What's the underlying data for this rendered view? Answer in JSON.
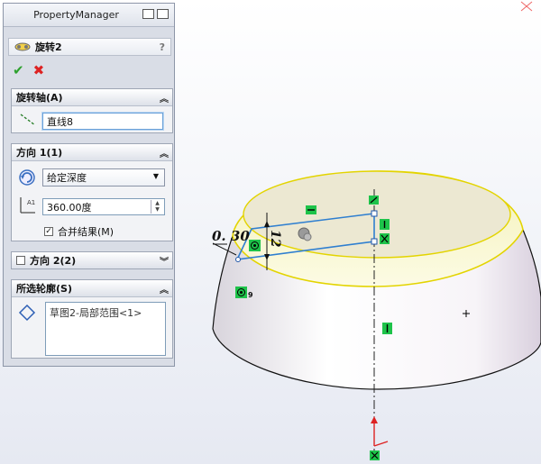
{
  "panel": {
    "title": "PropertyManager",
    "feature_name": "旋转2",
    "help": "?",
    "ok_glyph": "✔",
    "cancel_glyph": "✖"
  },
  "axis_group": {
    "title": "旋转轴(A)",
    "value": "直线8"
  },
  "direction1": {
    "title": "方向 1(1)",
    "end_condition": "给定深度",
    "angle": "360.00度",
    "merge_label": "合并结果(M)",
    "merge_checked": true
  },
  "direction2": {
    "title": "方向 2(2)"
  },
  "contours": {
    "title": "所选轮廓(S)",
    "item": "草图2-局部范围<1>"
  },
  "sketch": {
    "dim_chamfer": "0. 30",
    "dim_height": "12",
    "relation_label": "9"
  },
  "colors": {
    "relation_green": "#1ec34a",
    "sketch_blue": "#2f7fd0",
    "face_yellow": "#f5f2c2"
  }
}
